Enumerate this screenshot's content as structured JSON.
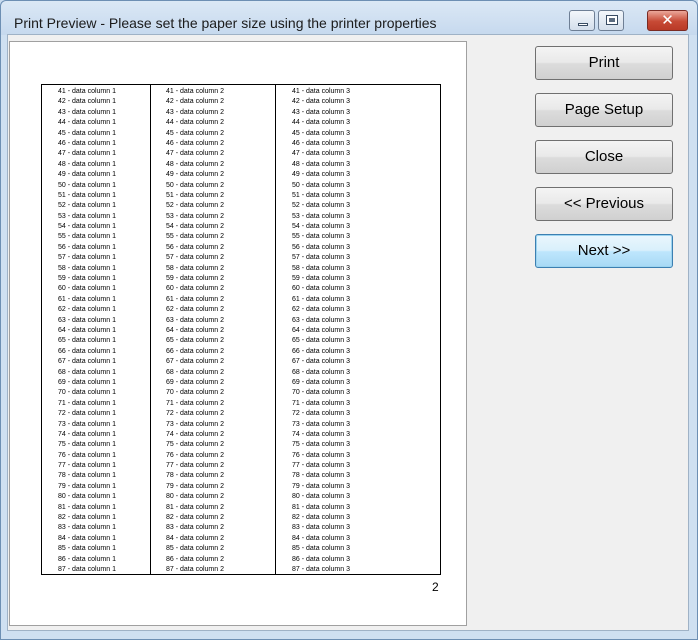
{
  "window": {
    "title": "Print Preview - Please set the paper size using the printer properties",
    "minimize_glyph": "",
    "close_glyph": "✕"
  },
  "preview": {
    "page_number": "2",
    "columns": [
      {
        "suffix": " - data column 1"
      },
      {
        "suffix": " - data column 2"
      },
      {
        "suffix": " - data column 3"
      }
    ],
    "row_start": 41,
    "row_end": 87
  },
  "buttons": {
    "print": "Print",
    "page_setup": "Page Setup",
    "close": "Close",
    "previous": "<< Previous",
    "next": "Next >>"
  }
}
